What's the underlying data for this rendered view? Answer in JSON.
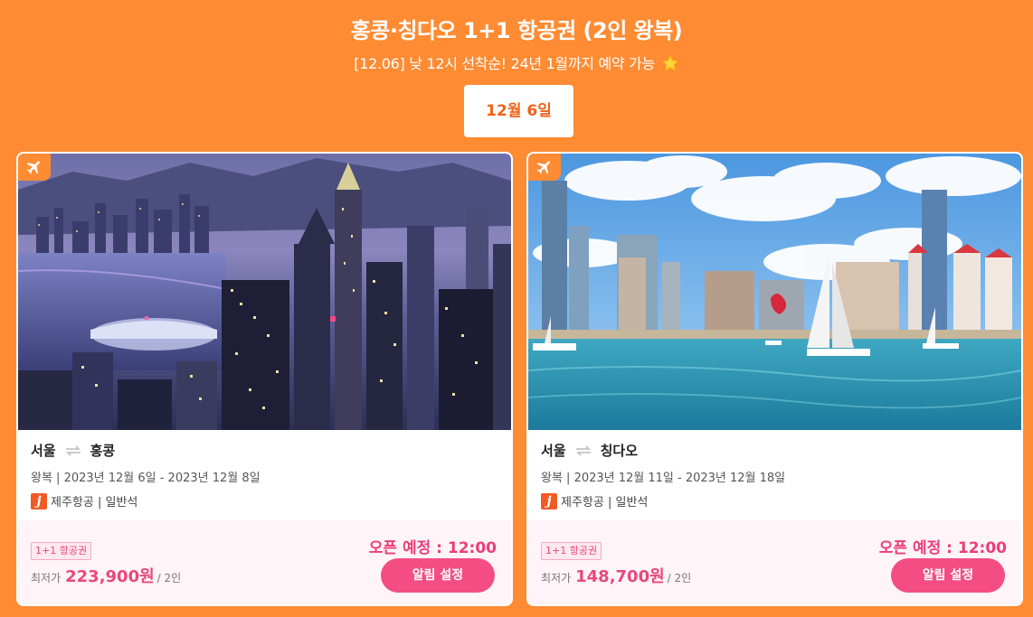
{
  "header": {
    "title": "홍콩·칭다오 1+1 항공권 (2인 왕복)",
    "subtitle": "[12.06] 낮 12시 선착순! 24년 1월까지 예약 가능",
    "star_icon": "star-icon"
  },
  "date_tab": {
    "label": "12월 6일"
  },
  "colors": {
    "background": "#FF8B33",
    "accent_pink": "#F34D84",
    "tab_text": "#F0621A"
  },
  "cards": [
    {
      "origin": "서울",
      "destination": "홍콩",
      "dates": "왕복 | 2023년 12월 6일 - 2023년 12월 8일",
      "airline_logo": "j",
      "airline": "제주항공 | 일반석",
      "promo_badge": "1+1 항공권",
      "price_label": "최저가",
      "price": "223,900원",
      "per": "/ 2인",
      "open_time": "오픈 예정 : 12:00",
      "button": "알림 설정"
    },
    {
      "origin": "서울",
      "destination": "칭다오",
      "dates": "왕복 | 2023년 12월 11일 - 2023년 12월 18일",
      "airline_logo": "j",
      "airline": "제주항공 | 일반석",
      "promo_badge": "1+1 항공권",
      "price_label": "최저가",
      "price": "148,700원",
      "per": "/ 2인",
      "open_time": "오픈 예정 : 12:00",
      "button": "알림 설정"
    }
  ]
}
